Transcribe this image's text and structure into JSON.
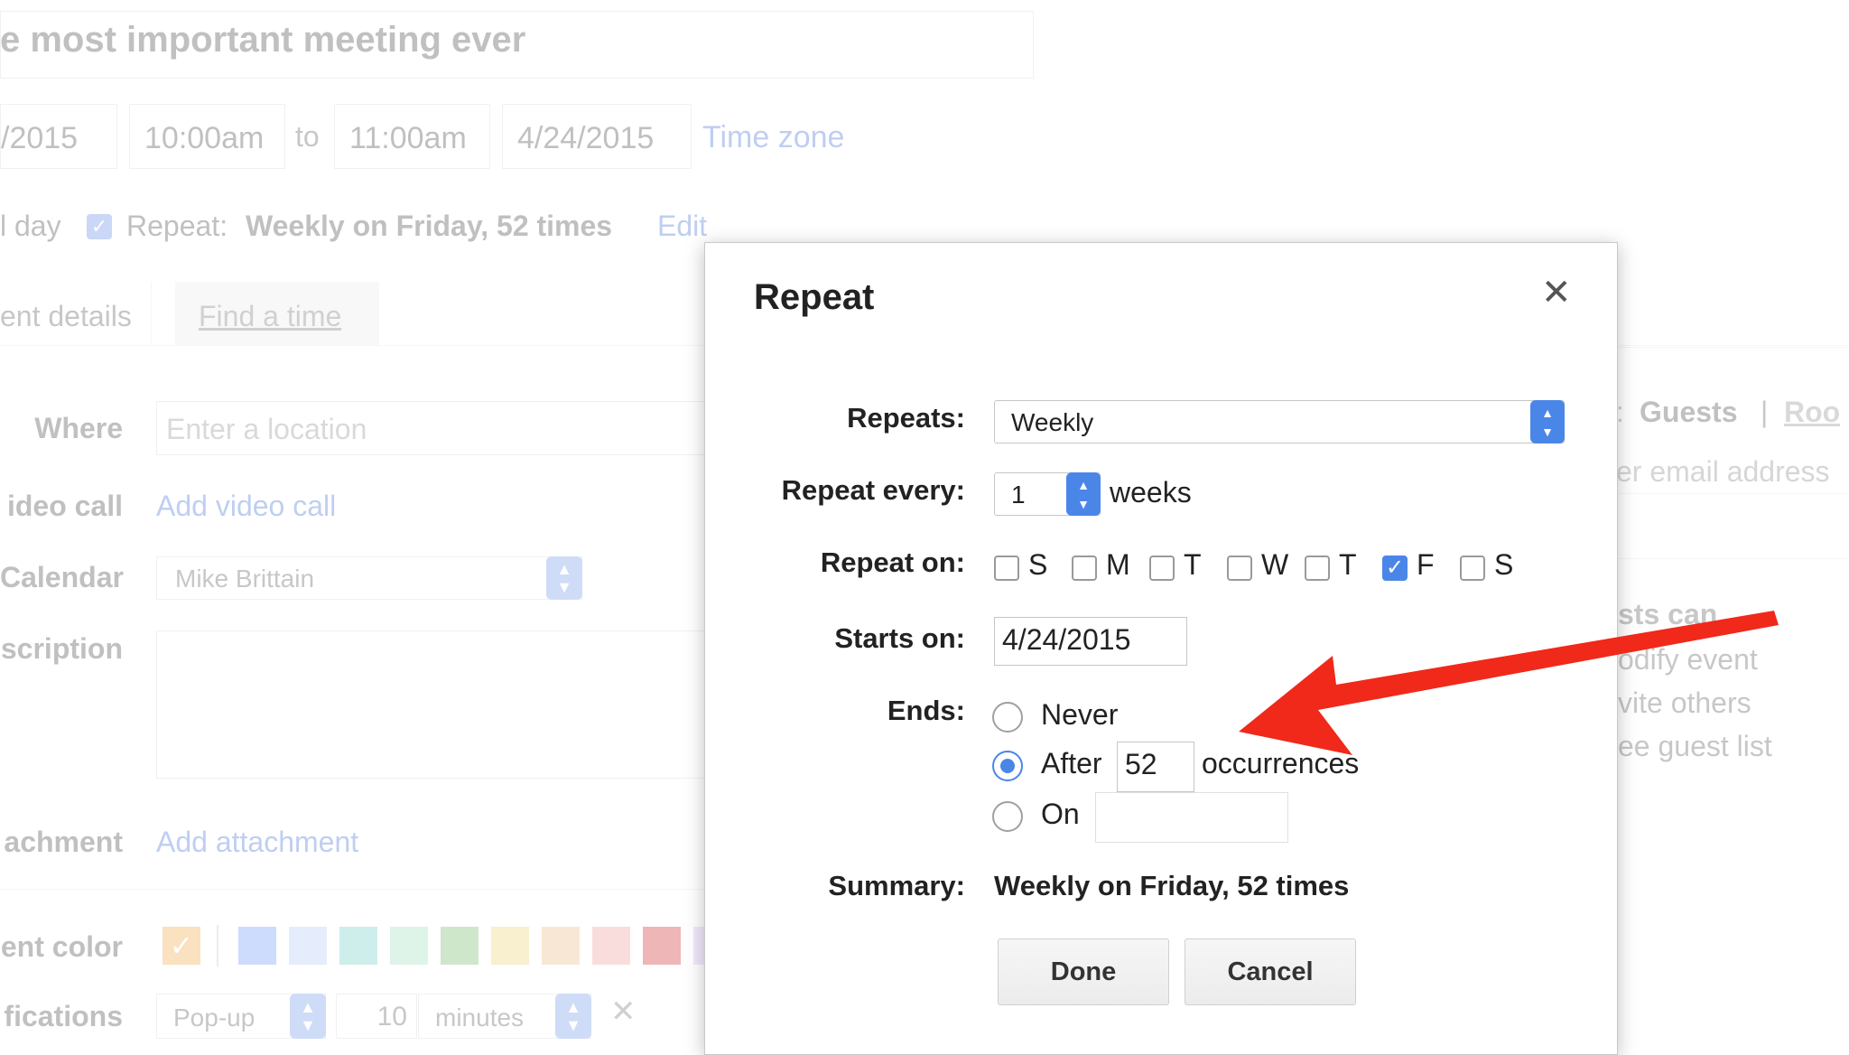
{
  "event": {
    "title": "e most important meeting ever",
    "start_date": "/2015",
    "start_time": "10:00am",
    "to_label": "to",
    "end_time": "11:00am",
    "end_date": "4/24/2015",
    "time_zone_link": "Time zone",
    "all_day_label": "l day",
    "repeat_label": "Repeat:",
    "repeat_summary": "Weekly on Friday, 52 times",
    "repeat_edit_link": "Edit"
  },
  "tabs": {
    "event_details": "ent details",
    "find_a_time": "Find a time"
  },
  "form": {
    "where_label": "Where",
    "where_placeholder": "Enter a location",
    "video_label": "ideo call",
    "video_link": "Add video call",
    "calendar_label": "Calendar",
    "calendar_value": "Mike Brittain",
    "description_label": "scription",
    "attachment_label": "achment",
    "attachment_link": "Add attachment",
    "color_label": "ent color",
    "notifications_label": "fications",
    "notification_type": "Pop-up",
    "notification_amount": "10",
    "notification_unit": "minutes"
  },
  "colors": [
    "#a4bdfc",
    "#cfdcf7",
    "#a5e0d9",
    "#c3ebd6",
    "#a6d3a0",
    "#f3e3a6",
    "#f5d3b5",
    "#f4c1bf",
    "#e07a7a",
    "#e8d8fa"
  ],
  "guests_panel": {
    "guests_tab": "Guests",
    "divider": "|",
    "rooms_tab": "Roo",
    "email_placeholder": "er email address",
    "guests_can": "sts can",
    "modify_event": "odify event",
    "invite_others": "vite others",
    "see_guest_list": "ee guest list"
  },
  "modal": {
    "title": "Repeat",
    "repeats_label": "Repeats:",
    "repeats_value": "Weekly",
    "repeat_every_label": "Repeat every:",
    "repeat_every_value": "1",
    "repeat_every_unit": "weeks",
    "repeat_on_label": "Repeat on:",
    "days": [
      {
        "label": "S",
        "checked": false
      },
      {
        "label": "M",
        "checked": false
      },
      {
        "label": "T",
        "checked": false
      },
      {
        "label": "W",
        "checked": false
      },
      {
        "label": "T",
        "checked": false
      },
      {
        "label": "F",
        "checked": true
      },
      {
        "label": "S",
        "checked": false
      }
    ],
    "starts_on_label": "Starts on:",
    "starts_on_value": "4/24/2015",
    "ends_label": "Ends:",
    "ends_never": "Never",
    "ends_after": "After",
    "ends_after_value": "52",
    "ends_after_unit": "occurrences",
    "ends_on": "On",
    "ends_selected": "after",
    "summary_label": "Summary:",
    "summary_value": "Weekly on Friday, 52 times",
    "done_button": "Done",
    "cancel_button": "Cancel"
  },
  "annotation": {
    "arrow_color": "#f0291a"
  }
}
